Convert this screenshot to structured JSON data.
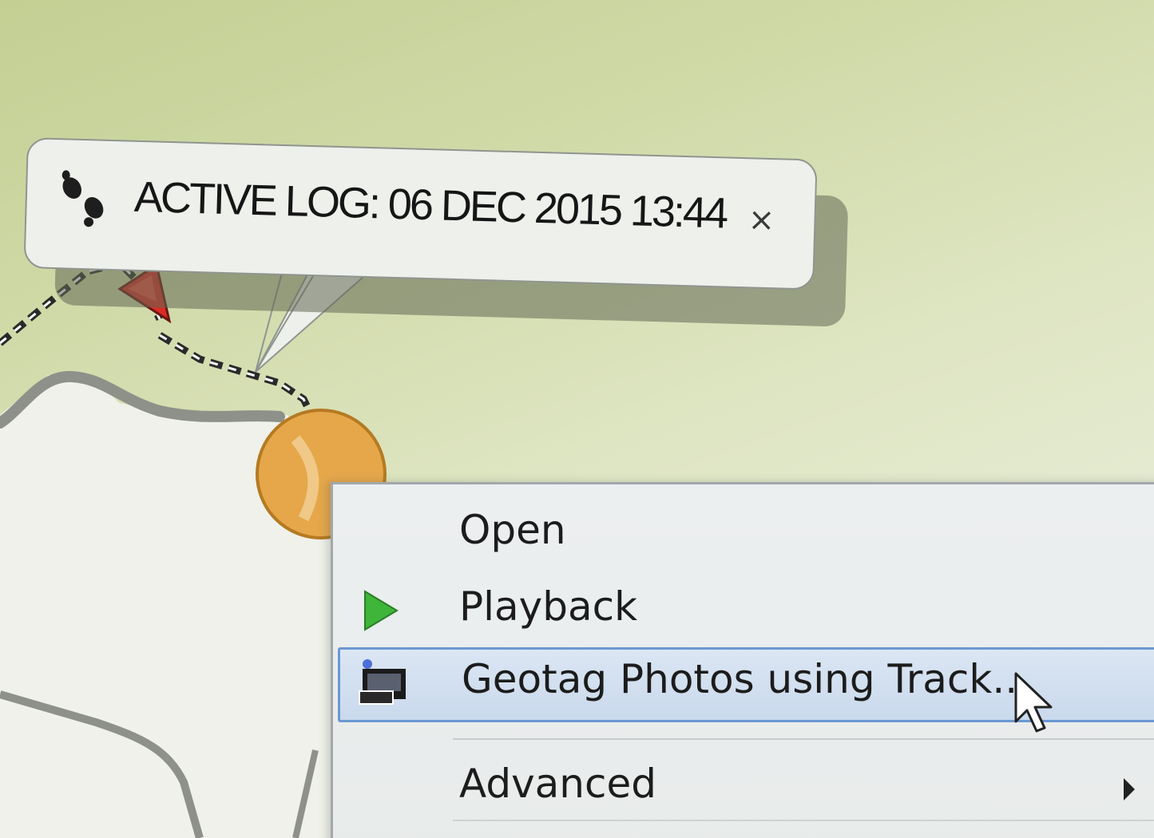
{
  "tooltip": {
    "title": "ACTIVE LOG: 06 DEC 2015 13:44",
    "close_label": "×",
    "icon": "footprints-icon"
  },
  "map": {
    "track_icon": "chain-track",
    "marker_icon": "red-arrow-marker",
    "waypoint_icon": "orange-circle-marker"
  },
  "context_menu": {
    "items": [
      {
        "label": "Open",
        "icon": ""
      },
      {
        "label": "Playback",
        "icon": "play-icon"
      },
      {
        "label": "Geotag Photos using Track...",
        "icon": "camera-photo-icon",
        "highlighted": true
      },
      {
        "label": "Advanced",
        "icon": "",
        "submenu": true
      }
    ]
  },
  "colors": {
    "highlight_border": "#6a98d2",
    "highlight_fill": "#c9d9ec",
    "play_green": "#3fb53a",
    "marker_red": "#d92b24",
    "waypoint_orange": "#e5a74a"
  }
}
